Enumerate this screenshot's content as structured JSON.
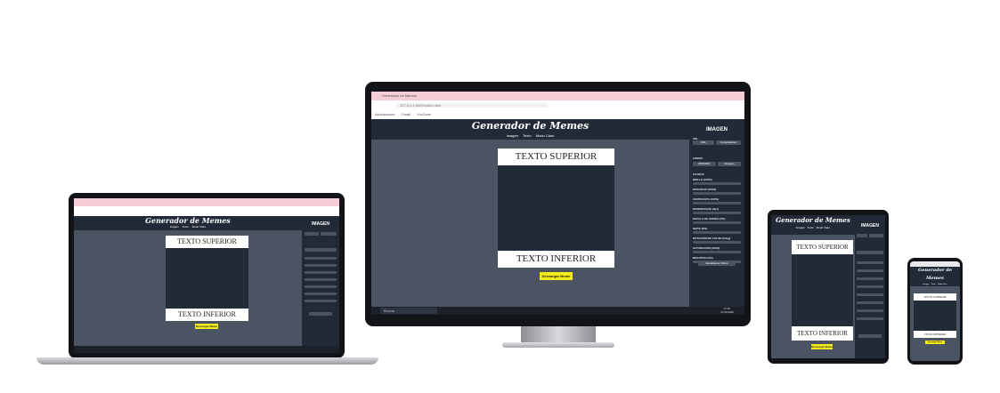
{
  "app": {
    "title": "Generador de Memes",
    "nav": {
      "image": "Imagen",
      "text": "Texto",
      "mode": "Modo Claro"
    },
    "meme_top": "TEXTO SUPERIOR",
    "meme_bottom": "TEXTO INFERIOR",
    "download": "Descargar Meme",
    "panel": {
      "heading": "IMAGEN",
      "url_section": "URL",
      "url_button": "URL",
      "computer_button": "Computadora",
      "background_label": "FONDO",
      "color_value": "#FFFFFF",
      "blend_mode": "Ninguno",
      "filters_label": "FILTROS",
      "filters": [
        "BRILLO (100%)",
        "OPACIDAD (100%)",
        "CONTRASTE (100%)",
        "DESENFOQUE (0px)",
        "ESCALA DE GRISES (0%)",
        "SEPIA (0%)",
        "ROTACIÓN DE COLOR (0deg)",
        "SATURACIÓN (100%)",
        "NEGATIVO (0%)"
      ],
      "reset": "Restablecer Filtros"
    }
  },
  "desktop": {
    "tab": "Generador de Memes",
    "url": "127.0.0.1:5500/index.html",
    "bookmarks": [
      "Aplicaciones",
      "Gmail",
      "YouTube"
    ],
    "search": "Buscar",
    "time": "17:26",
    "date": "27/11/2020"
  },
  "colors": {
    "header": "#222a38",
    "canvas_bg": "#4a5463",
    "button": "#f4ec1a",
    "browser_chrome": "#f4cdd6"
  }
}
